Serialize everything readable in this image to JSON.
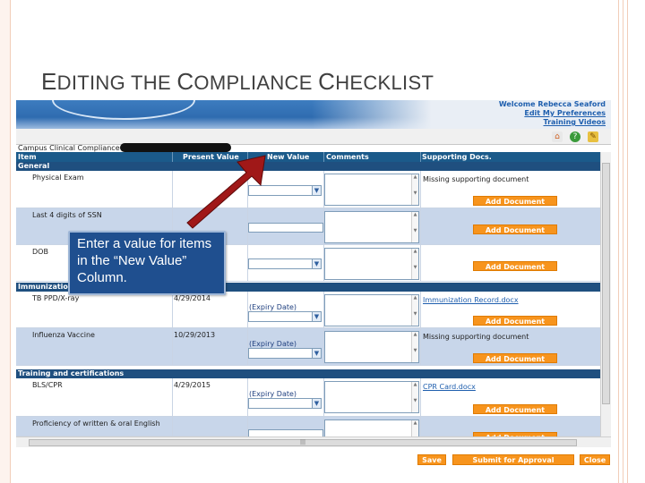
{
  "slide": {
    "title_parts": [
      {
        "text": "E",
        "big": true
      },
      {
        "text": "DITING THE ",
        "big": false
      },
      {
        "text": "C",
        "big": true
      },
      {
        "text": "OMPLIANCE ",
        "big": false
      },
      {
        "text": "C",
        "big": true
      },
      {
        "text": "HECKLIST",
        "big": false
      }
    ]
  },
  "app": {
    "welcome": "Welcome Rebecca Seaford",
    "edit_prefs": "Edit My Preferences",
    "training_videos": "Training Videos",
    "breadcrumb": "Campus Clinical Compliance",
    "columns": [
      "Item",
      "Present Value",
      "New Value",
      "Comments",
      "Supporting Docs."
    ],
    "sections": [
      {
        "name": "General"
      },
      {
        "name": "Immunization"
      },
      {
        "name": "Training and certifications"
      }
    ],
    "rows": [
      {
        "item": "Physical Exam",
        "present": "",
        "support": "Missing supporting document",
        "button": "Add Document"
      },
      {
        "item": "Last 4 digits of SSN",
        "present": "",
        "support": "",
        "button": "Add Document"
      },
      {
        "item": "DOB",
        "present": "",
        "support": "",
        "button": "Add Document"
      },
      {
        "item": "TB PPD/X-ray",
        "present": "4/29/2014",
        "expiry": "(Expiry Date)",
        "support_link": "Immunization Record.docx",
        "button": "Add Document"
      },
      {
        "item": "Influenza Vaccine",
        "present": "10/29/2013",
        "expiry": "(Expiry Date)",
        "support": "Missing supporting document",
        "button": "Add Document"
      },
      {
        "item": "BLS/CPR",
        "present": "4/29/2015",
        "expiry": "(Expiry Date)",
        "support_link": "CPR Card.docx",
        "button": "Add Document"
      },
      {
        "item": "Proficiency of written & oral English",
        "present": "",
        "button": "Add Document"
      }
    ],
    "footer": {
      "save": "Save",
      "submit": "Submit for Approval",
      "close": "Close"
    }
  },
  "callout": {
    "text": "Enter a value for items in the “New Value” Column."
  },
  "colors": {
    "header": "#1b5a8a",
    "section": "#1f4f7f",
    "alt_row": "#c8d6ea",
    "button": "#f7941d",
    "arrow": "#a01818",
    "callout": "#1f4f8f"
  },
  "icons": {
    "home": "home-icon",
    "help": "help-icon",
    "edit": "edit-icon"
  }
}
